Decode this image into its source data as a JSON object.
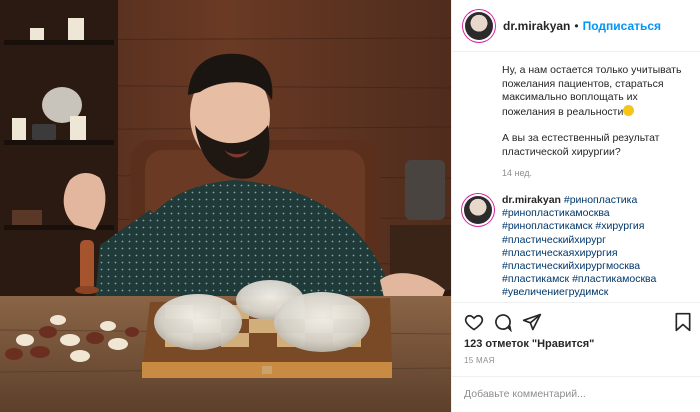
{
  "post": {
    "image_alt": "Bearded man in dark shirt at a chessboard with three silicone breast implants on it",
    "header": {
      "username": "dr.mirakyan",
      "separator": "•",
      "follow_label": "Подписаться"
    },
    "caption": {
      "line1": "Ну, а нам остается только учитывать пожелания пациентов, стараться максимально воплощать их пожелания в реальности",
      "line2": "А вы за естественный результат пластической хирургии?",
      "time": "14 нед."
    },
    "comment": {
      "username": "dr.mirakyan",
      "tags": [
        "#ринопластика",
        "#ринопластикамосква",
        "#ринопластикамск",
        "#хирургия",
        "#пластическийхирург",
        "#пластическаяхирургия",
        "#пластическийхирургмосква",
        "#пластикамск",
        "#пластикамосква",
        "#увеличениегрудимск"
      ]
    },
    "likes": "123 отметок \"Нравится\"",
    "date": "15 МАЯ",
    "add_comment_placeholder": "Добавьте комментарий...",
    "icons": [
      "heart-icon",
      "comment-icon",
      "share-icon",
      "bookmark-icon"
    ]
  }
}
